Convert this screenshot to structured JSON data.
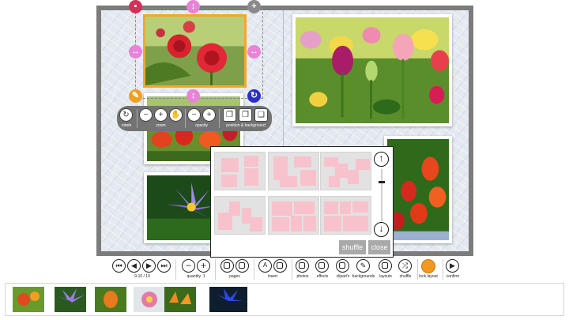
{
  "photo_toolbar": {
    "rotate_label": "rotate",
    "zoom_label": "zoom",
    "opacity_label": "opacity",
    "position_label": "position & background"
  },
  "layout_popup": {
    "shuffle_label": "shuffle",
    "close_label": "close"
  },
  "toolbar": {
    "page_range": "9-10 / 10",
    "quantity_label": "quantity: 1",
    "pages_label": "pages",
    "insert_label": "insert",
    "photos_label": "photos",
    "effects_label": "effects",
    "cliparts_label": "clipart's",
    "backgrounds_label": "backgrounds",
    "layouts_label": "layouts",
    "shuffle_label": "shuffle",
    "lock_label": "lock layout",
    "confirm_label": "confirm"
  },
  "colors": {
    "selection": "#f0a928",
    "handle_pink": "#e884d8",
    "handle_red": "#d23257",
    "handle_orange": "#f0a020",
    "handle_blue": "#2c2ec8",
    "layout_block": "#f7c2cc",
    "lock_button": "#f29a1d"
  },
  "icons": [
    "delete-icon",
    "move-icon",
    "add-icon",
    "resize-icon",
    "edit-icon",
    "rotate-icon",
    "zoom-in-icon",
    "zoom-out-icon",
    "hand-icon",
    "minus-icon",
    "plus-icon",
    "arrange-icon",
    "scroll-up-icon",
    "scroll-down-icon",
    "first-page-icon",
    "prev-page-icon",
    "next-page-icon",
    "last-page-icon",
    "lock-icon",
    "confirm-icon"
  ]
}
